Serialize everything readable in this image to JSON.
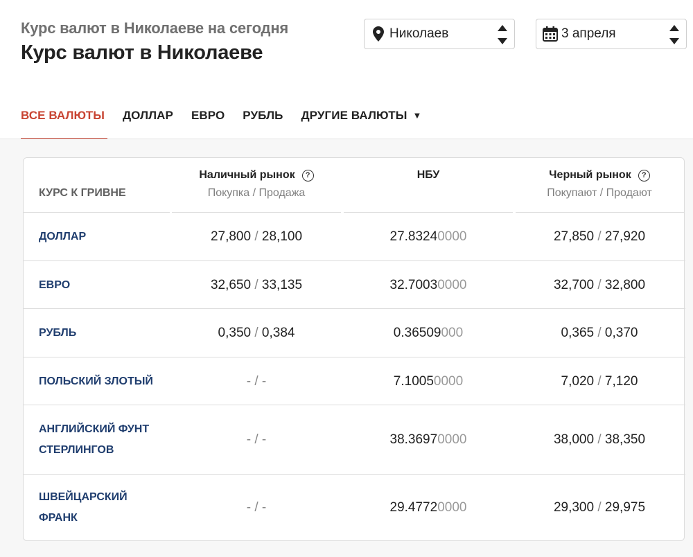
{
  "header": {
    "subtitle": "Курс валют в Николаеве на сегодня",
    "title": "Курс валют в Николаеве",
    "city_select": {
      "value": "Николаев",
      "icon": "location-pin-icon"
    },
    "date_select": {
      "value": "3 апреля",
      "icon": "calendar-icon"
    }
  },
  "tabs": [
    {
      "label": "ВСЕ ВАЛЮТЫ",
      "active": true
    },
    {
      "label": "ДОЛЛАР",
      "active": false
    },
    {
      "label": "ЕВРО",
      "active": false
    },
    {
      "label": "РУБЛЬ",
      "active": false
    },
    {
      "label": "ДРУГИЕ ВАЛЮТЫ",
      "active": false,
      "caret": "▼"
    }
  ],
  "table": {
    "label_header": "КУРС К ГРИВНЕ",
    "columns": [
      {
        "title": "Наличный рынок",
        "sub": "Покупка / Продажа",
        "help_icon": "?"
      },
      {
        "title": "НБУ",
        "sub": ""
      },
      {
        "title": "Черный рынок",
        "sub": "Покупают / Продают",
        "help_icon": "?"
      }
    ],
    "rows": [
      {
        "name": [
          "ДОЛЛАР"
        ],
        "cash": [
          "27,800",
          "28,100"
        ],
        "nbu": [
          "27.8324",
          "0000"
        ],
        "black": [
          "27,850",
          "27,920"
        ]
      },
      {
        "name": [
          "ЕВРО"
        ],
        "cash": [
          "32,650",
          "33,135"
        ],
        "nbu": [
          "32.7003",
          "0000"
        ],
        "black": [
          "32,700",
          "32,800"
        ]
      },
      {
        "name": [
          "РУБЛЬ"
        ],
        "cash": [
          "0,350",
          "0,384"
        ],
        "nbu": [
          "0.36509",
          "000"
        ],
        "black": [
          "0,365",
          "0,370"
        ]
      },
      {
        "name": [
          "ПОЛЬСКИЙ ЗЛОТЫЙ"
        ],
        "cash": [
          "-",
          "-"
        ],
        "nbu": [
          "7.1005",
          "0000"
        ],
        "black": [
          "7,020",
          "7,120"
        ]
      },
      {
        "name": [
          "АНГЛИЙСКИЙ ФУНТ",
          "СТЕРЛИНГОВ"
        ],
        "cash": [
          "-",
          "-"
        ],
        "nbu": [
          "38.3697",
          "0000"
        ],
        "black": [
          "38,000",
          "38,350"
        ]
      },
      {
        "name": [
          "ШВЕЙЦАРСКИЙ",
          "ФРАНК"
        ],
        "cash": [
          "-",
          "-"
        ],
        "nbu": [
          "29.4772",
          "0000"
        ],
        "black": [
          "29,300",
          "29,975"
        ]
      }
    ],
    "separator": "/"
  },
  "colors": {
    "accent": "#c84432",
    "currency_name": "#1f3d6e",
    "muted": "#808080"
  }
}
